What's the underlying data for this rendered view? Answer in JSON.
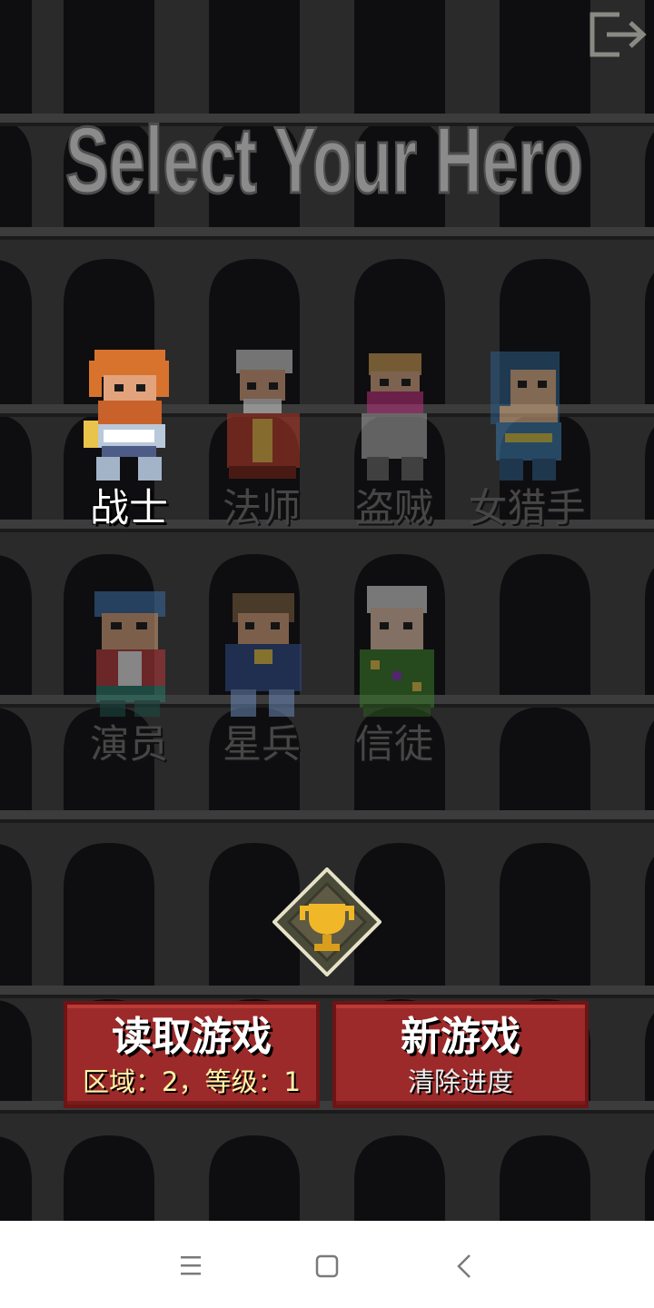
{
  "screen": {
    "title": "Select Your Hero"
  },
  "heroes": [
    {
      "id": "warrior",
      "label": "战士",
      "state": "selected"
    },
    {
      "id": "mage",
      "label": "法师",
      "state": "locked"
    },
    {
      "id": "rogue",
      "label": "盗贼",
      "state": "locked"
    },
    {
      "id": "huntress",
      "label": "女猎手",
      "state": "locked"
    },
    {
      "id": "actor",
      "label": "演员",
      "state": "locked"
    },
    {
      "id": "starsoldier",
      "label": "星兵",
      "state": "locked"
    },
    {
      "id": "believer",
      "label": "信徒",
      "state": "locked"
    }
  ],
  "buttons": {
    "load": {
      "label": "读取游戏",
      "detail": "区域：2，等级：1"
    },
    "new": {
      "label": "新游戏",
      "detail": "清除进度"
    }
  },
  "icons": {
    "exit": "exit-icon",
    "trophy": "trophy-icon",
    "nav": [
      "menu-icon",
      "home-icon",
      "back-icon"
    ]
  },
  "colors": {
    "background": "#2a2a2b",
    "button_red": "#9c2a2a",
    "label_active": "#ffffff",
    "label_locked": "#464646",
    "detail_yellow": "#fff5a8"
  }
}
